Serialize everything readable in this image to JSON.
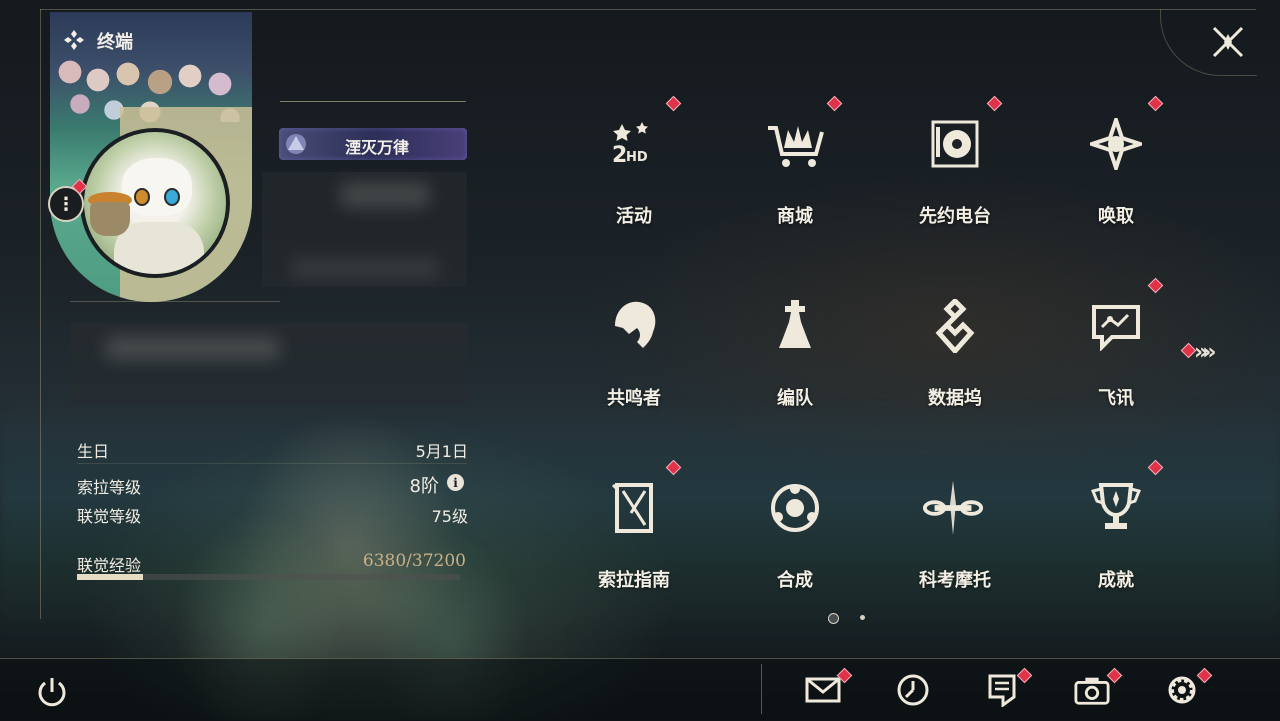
{
  "header": {
    "title": "终端"
  },
  "profile": {
    "title_badge": "湮灭万律",
    "stats": {
      "birthday_label": "生日",
      "birthday_value": "5月1日",
      "sola_level_label": "索拉等级",
      "sola_level_value": "8阶",
      "union_level_label": "联觉等级",
      "union_level_value": "75级",
      "exp_label": "联觉经验",
      "exp_value": "6380/37200",
      "exp_progress": 0.1715
    }
  },
  "menu": [
    {
      "label": "活动",
      "icon": "event-2hd-icon",
      "badge": true
    },
    {
      "label": "商城",
      "icon": "shop-cart-icon",
      "badge": true
    },
    {
      "label": "先约电台",
      "icon": "radio-icon",
      "badge": true
    },
    {
      "label": "唤取",
      "icon": "summon-compass-icon",
      "badge": true
    },
    {
      "label": "共鸣者",
      "icon": "resonator-portrait-icon",
      "badge": false
    },
    {
      "label": "编队",
      "icon": "team-chess-icon",
      "badge": false
    },
    {
      "label": "数据坞",
      "icon": "data-bank-icon",
      "badge": false
    },
    {
      "label": "飞讯",
      "icon": "message-chat-icon",
      "badge": true
    },
    {
      "label": "索拉指南",
      "icon": "guide-book-icon",
      "badge": true
    },
    {
      "label": "合成",
      "icon": "synthesis-icon",
      "badge": false
    },
    {
      "label": "科考摩托",
      "icon": "motorcycle-icon",
      "badge": false
    },
    {
      "label": "成就",
      "icon": "trophy-icon",
      "badge": true
    }
  ],
  "pagination": {
    "current": 1,
    "total": 2
  },
  "bottom_bar": [
    {
      "name": "power-icon"
    },
    {
      "name": "mail-icon",
      "badge": true
    },
    {
      "name": "clock-icon",
      "badge": false
    },
    {
      "name": "notice-icon",
      "badge": true
    },
    {
      "name": "camera-icon",
      "badge": true
    },
    {
      "name": "settings-gear-icon",
      "badge": true
    }
  ],
  "colors": {
    "accent_gold": "#c8b18a",
    "badge_red": "#e0334a"
  }
}
